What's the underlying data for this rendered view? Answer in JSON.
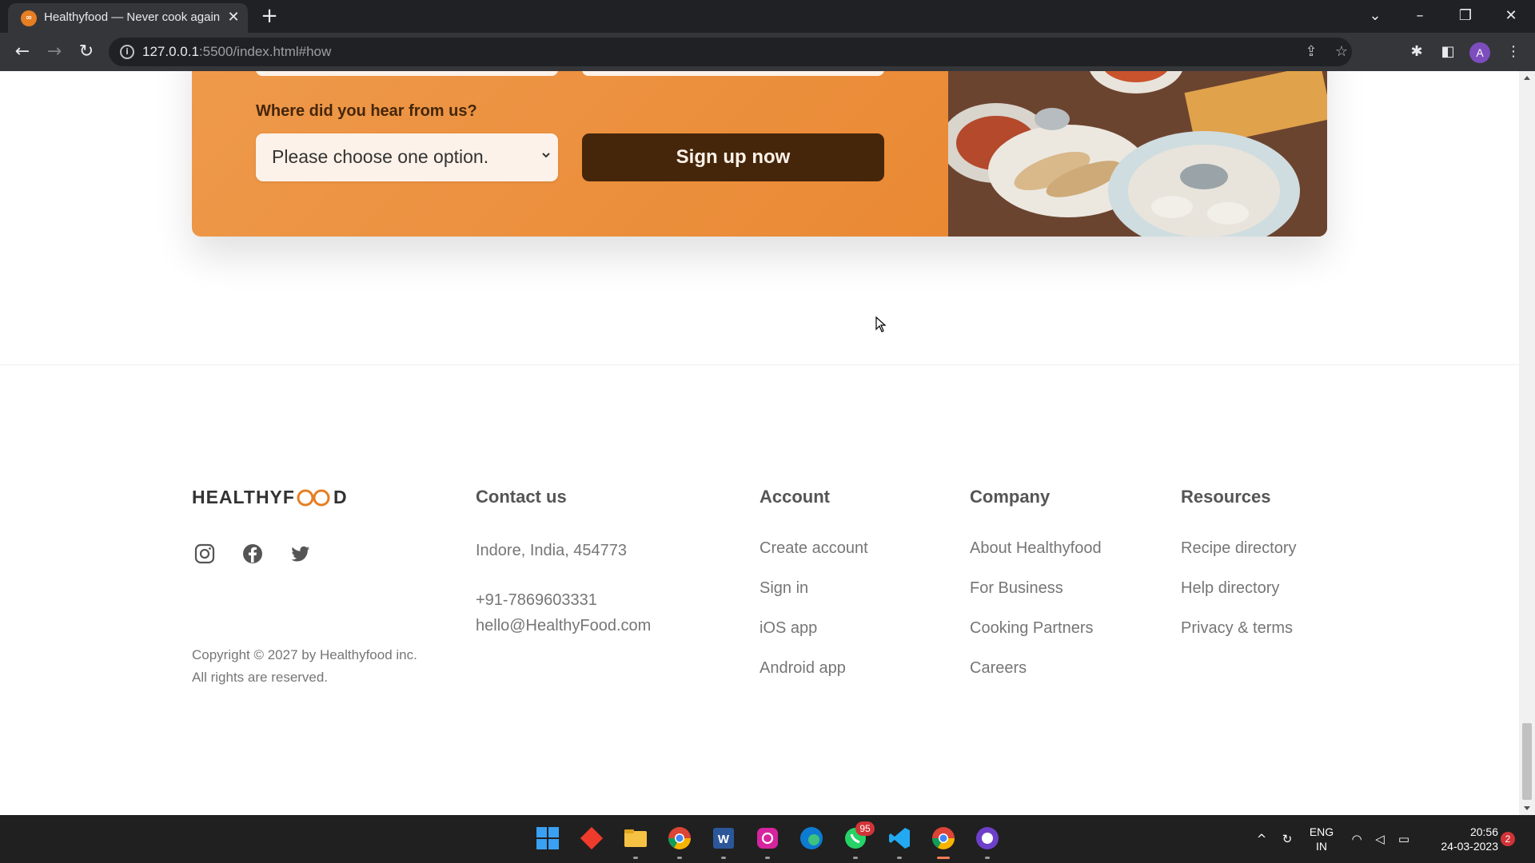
{
  "browser": {
    "tab_title": "Healthyfood — Never cook again!",
    "tab_favicon_text": "∞",
    "new_tab_label": "+",
    "url_host": "127.0.0.1",
    "url_rest": ":5500/index.html#how",
    "profile_initial": "A"
  },
  "cta": {
    "question_label": "Where did you hear from us?",
    "select_value": "Please choose one option.",
    "button_label": "Sign up now"
  },
  "footer": {
    "logo_left": "HEALTHYF",
    "logo_right": "D",
    "copyright": "Copyright © 2027 by Healthyfood inc. All rights are reserved.",
    "social": [
      "instagram-icon",
      "facebook-icon",
      "twitter-icon"
    ],
    "contact": {
      "title": "Contact us",
      "address": "Indore, India, 454773",
      "phone": "+91-7869603331",
      "email": "hello@HealthyFood.com"
    },
    "account": {
      "title": "Account",
      "links": [
        "Create account",
        "Sign in",
        "iOS app",
        "Android app"
      ]
    },
    "company": {
      "title": "Company",
      "links": [
        "About Healthyfood",
        "For Business",
        "Cooking Partners",
        "Careers"
      ]
    },
    "resources": {
      "title": "Resources",
      "links": [
        "Recipe directory",
        "Help directory",
        "Privacy & terms"
      ]
    }
  },
  "taskbar": {
    "whatsapp_badge": "95",
    "lang_line1": "ENG",
    "lang_line2": "IN",
    "time": "20:56",
    "date": "24-03-2023",
    "notification_count": "2"
  },
  "colors": {
    "cta_orange": "#e8822a",
    "cta_dark": "#45260a",
    "logo_accent": "#e67e22"
  }
}
